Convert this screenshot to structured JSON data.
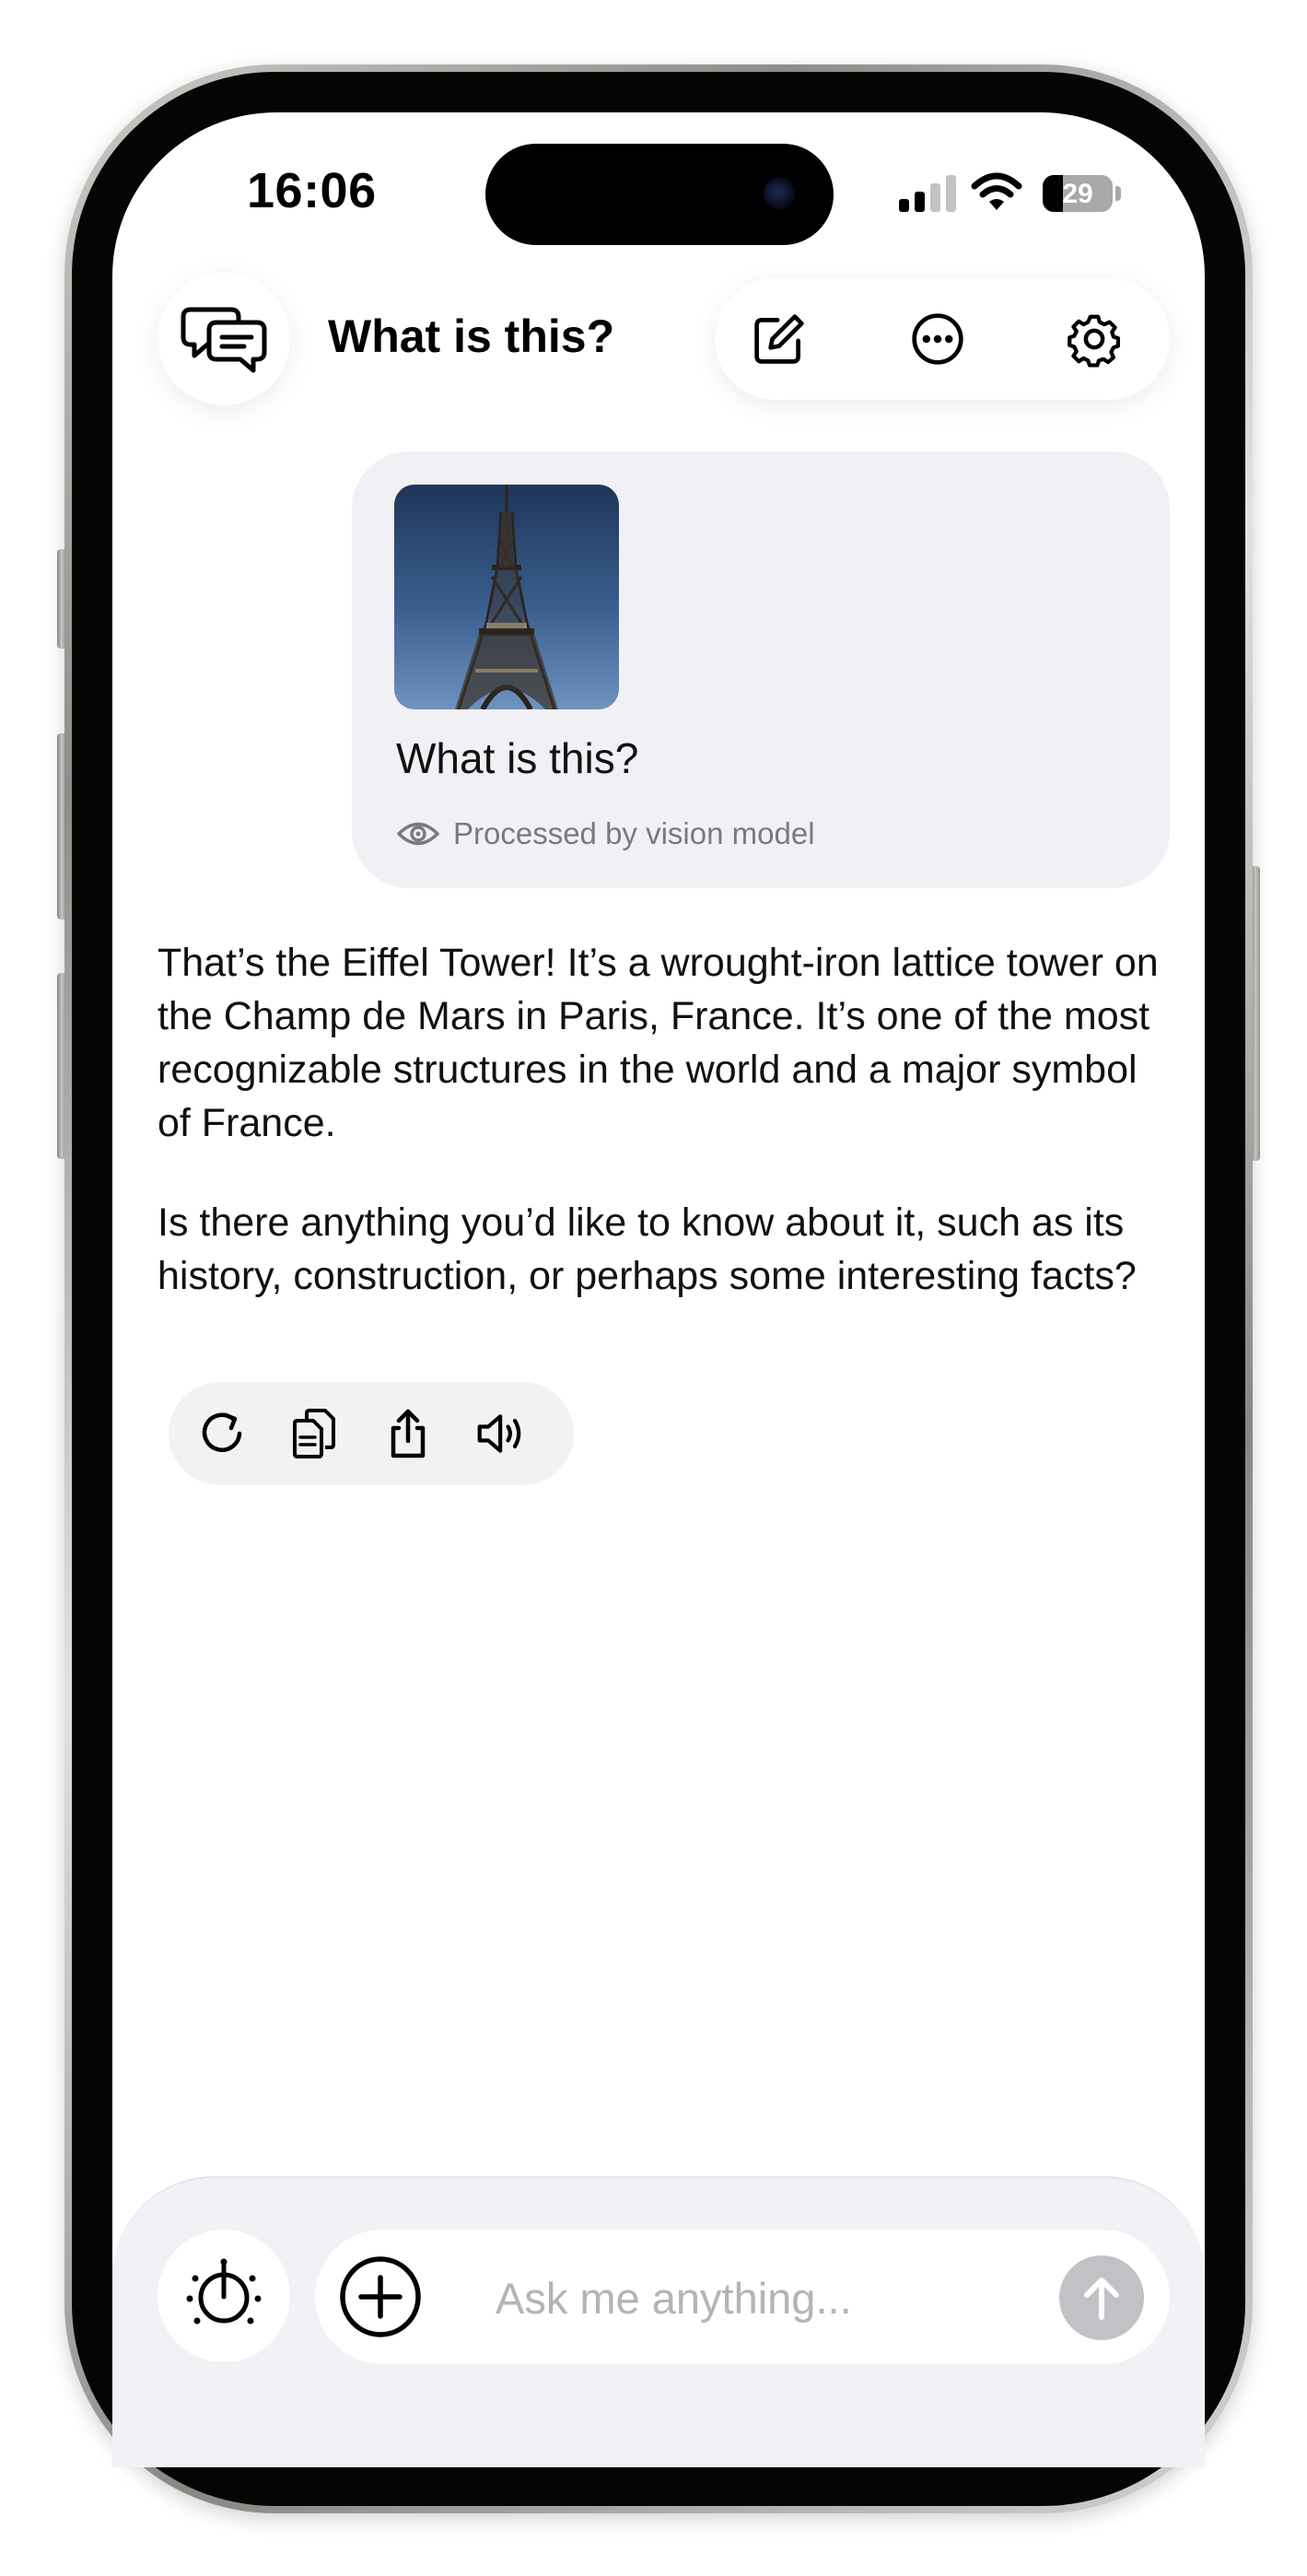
{
  "status_bar": {
    "time": "16:06",
    "battery_percent": "29",
    "battery_level": 0.29,
    "signal_bars": 2
  },
  "header": {
    "title": "What is this?",
    "icons": {
      "chats": "chat-bubbles-icon",
      "new_chat": "compose-icon",
      "more": "more-options-icon",
      "settings": "gear-icon"
    }
  },
  "user_message": {
    "image": "eiffel-tower-photo",
    "text": "What is this?",
    "vision_note": "Processed by vision model",
    "vision_icon": "eye-icon"
  },
  "assistant_message": {
    "paragraphs": [
      "That’s the Eiffel Tower! It’s a wrought-iron lattice tower on the Champ de Mars in Paris, France. It’s one of the most recognizable structures in the world and a major symbol of France.",
      "Is there anything you’d like to know about it, such as its history, construction, or perhaps some interesting facts?"
    ],
    "actions": [
      "regenerate-icon",
      "copy-icon",
      "share-icon",
      "speaker-icon"
    ]
  },
  "composer": {
    "placeholder": "Ask me anything...",
    "value": "",
    "icons": {
      "timer": "timer-icon",
      "add": "plus-circle-icon",
      "send": "arrow-up-icon"
    }
  },
  "colors": {
    "bubble_bg": "#f1f1f5",
    "composer_bg": "#f1f1f6",
    "send_disabled": "#c2c2c6",
    "muted_text": "#777a80"
  }
}
